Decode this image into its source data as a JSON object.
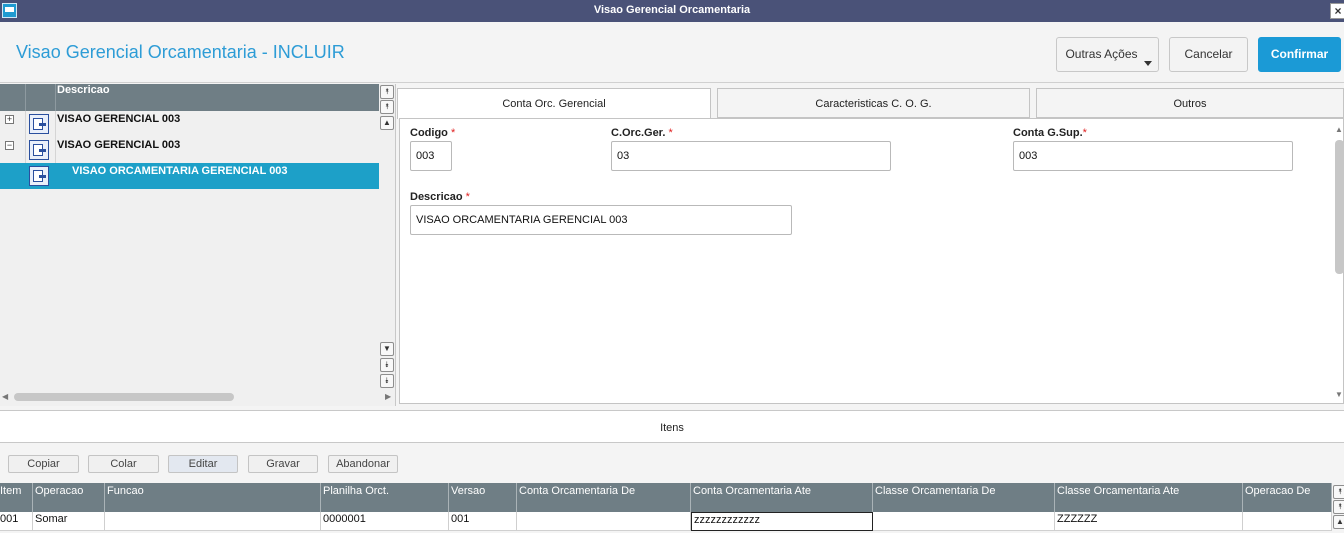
{
  "window": {
    "title": "Visao Gerencial Orcamentaria",
    "close_glyph": "×"
  },
  "header": {
    "title": "Visao Gerencial Orcamentaria - INCLUIR",
    "buttons": {
      "other_actions": "Outras Ações",
      "cancel": "Cancelar",
      "confirm": "Confirmar"
    },
    "accent_color": "#1b9ad6"
  },
  "tree": {
    "column_header": "Descricao",
    "rows": [
      {
        "label": "VISAO GERENCIAL 003",
        "expander": "+",
        "selected": false
      },
      {
        "label": "VISAO GERENCIAL 003",
        "expander": "−",
        "selected": false
      },
      {
        "label": "VISAO ORCAMENTARIA GERENCIAL 003",
        "expander": "",
        "selected": true
      }
    ]
  },
  "tabs": [
    {
      "label": "Conta Orc. Gerencial",
      "active": true
    },
    {
      "label": "Caracteristicas C. O. G.",
      "active": false
    },
    {
      "label": "Outros",
      "active": false
    }
  ],
  "form": {
    "codigo": {
      "label": "Codigo",
      "required": "*",
      "value": "003"
    },
    "corcger": {
      "label": "C.Orc.Ger.",
      "required": "*",
      "value": "03"
    },
    "contasup": {
      "label": "Conta G.Sup.",
      "required": "*",
      "value": "003"
    },
    "descricao": {
      "label": "Descricao",
      "required": "*",
      "value": "VISAO ORCAMENTARIA GERENCIAL 003"
    }
  },
  "items": {
    "section_label": "Itens",
    "toolbar": {
      "copy": "Copiar",
      "paste": "Colar",
      "edit": "Editar",
      "save": "Gravar",
      "abandon": "Abandonar"
    },
    "columns": [
      "Item",
      "Operacao",
      "Funcao",
      "Planilha Orct.",
      "Versao",
      "Conta Orcamentaria De",
      "Conta Orcamentaria Ate",
      "Classe Orcamentaria De",
      "Classe Orcamentaria Ate",
      "Operacao De"
    ],
    "rows": [
      [
        "001",
        "Somar",
        "",
        "0000001",
        "001",
        "",
        "zzzzzzzzzzzz",
        "",
        "ZZZZZZ",
        ""
      ]
    ]
  }
}
